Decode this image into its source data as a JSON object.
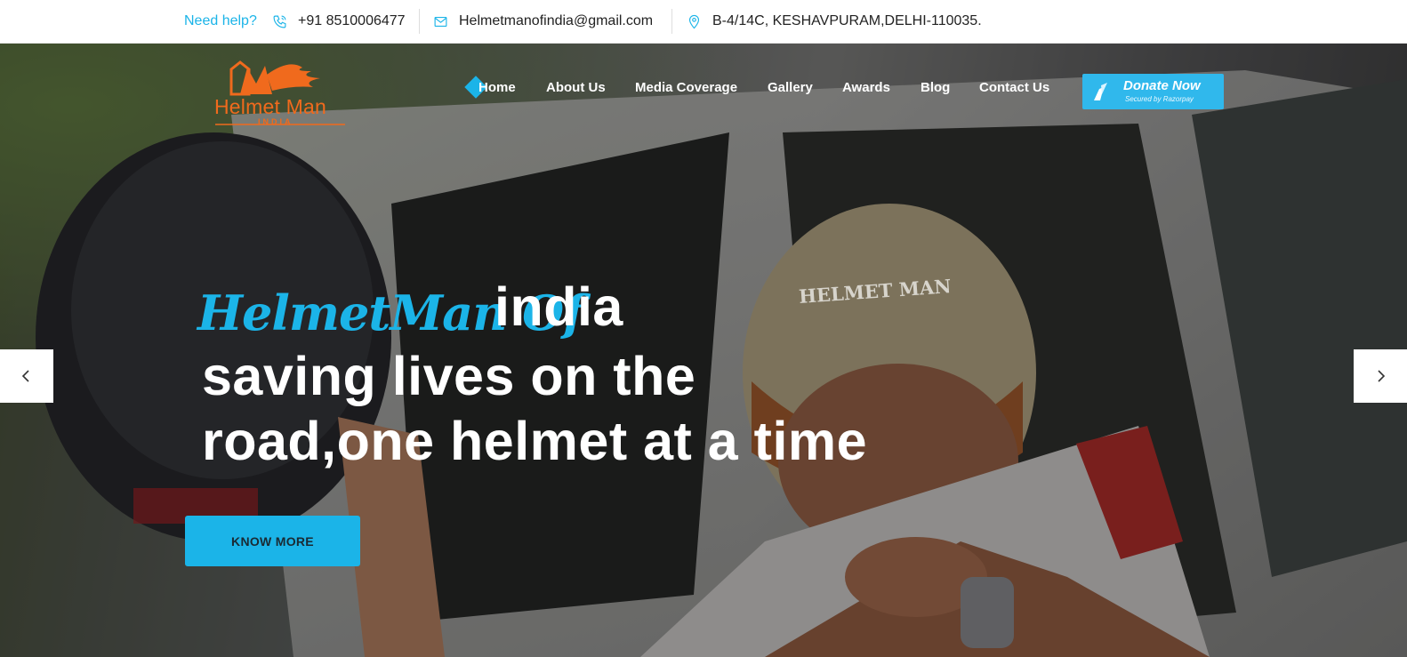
{
  "topbar": {
    "help_label": "Need help?",
    "phone": "+91 8510006477",
    "email": "Helmetmanofindia@gmail.com",
    "address": "B-4/14C, KESHAVPURAM,DELHI-110035.",
    "accent_color": "#1bb4e8"
  },
  "logo": {
    "name": "Helmet Man",
    "sub": "INDIA",
    "color": "#f06a1d"
  },
  "nav": {
    "items": [
      {
        "label": "Home",
        "active": true
      },
      {
        "label": "About Us"
      },
      {
        "label": "Media Coverage"
      },
      {
        "label": "Gallery"
      },
      {
        "label": "Awards"
      },
      {
        "label": "Blog"
      },
      {
        "label": "Contact Us"
      }
    ],
    "donate": {
      "label": "Donate Now",
      "sub": "Secured by Razorpay"
    }
  },
  "hero": {
    "script_title": "HelmetMan Of",
    "title_word": "india",
    "line2": "saving lives on the",
    "line3": "road,one helmet at a time",
    "cta": "KNOW MORE",
    "helmet_text": "HELMET MAN",
    "prev_icon": "chevron-left-icon",
    "next_icon": "chevron-right-icon"
  }
}
